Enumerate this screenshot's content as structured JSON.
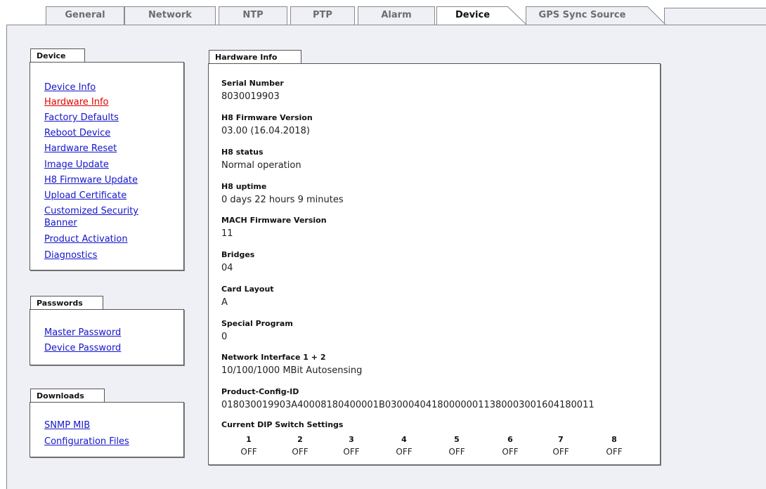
{
  "tabs": [
    {
      "label": "General"
    },
    {
      "label": "Network"
    },
    {
      "label": "NTP"
    },
    {
      "label": "PTP"
    },
    {
      "label": "Alarm"
    },
    {
      "label": "Device"
    },
    {
      "label": "GPS Sync Source"
    }
  ],
  "active_tab": "Device",
  "device_group": {
    "title": "Device",
    "links": [
      {
        "label": "Device Info"
      },
      {
        "label": "Hardware Info"
      },
      {
        "label": "Factory Defaults"
      },
      {
        "label": "Reboot Device"
      },
      {
        "label": "Hardware Reset"
      },
      {
        "label": "Image Update"
      },
      {
        "label": "H8 Firmware Update"
      },
      {
        "label": "Upload Certificate"
      },
      {
        "label": "Customized Security Banner"
      },
      {
        "label": "Product Activation"
      },
      {
        "label": "Diagnostics"
      }
    ],
    "active_link": "Hardware Info"
  },
  "passwords_group": {
    "title": "Passwords",
    "links": [
      {
        "label": "Master Password"
      },
      {
        "label": "Device Password"
      }
    ]
  },
  "downloads_group": {
    "title": "Downloads",
    "links": [
      {
        "label": "SNMP MIB"
      },
      {
        "label": "Configuration Files"
      }
    ]
  },
  "hardware_info": {
    "title": "Hardware Info",
    "fields": [
      {
        "label": "Serial Number",
        "value": "8030019903"
      },
      {
        "label": "H8 Firmware Version",
        "value": "03.00 (16.04.2018)"
      },
      {
        "label": "H8 status",
        "value": "Normal operation"
      },
      {
        "label": "H8 uptime",
        "value": "0 days 22 hours 9 minutes"
      },
      {
        "label": "MACH Firmware Version",
        "value": "11"
      },
      {
        "label": "Bridges",
        "value": "04"
      },
      {
        "label": "Card Layout",
        "value": "A"
      },
      {
        "label": "Special Program",
        "value": "0"
      },
      {
        "label": "Network Interface 1 + 2",
        "value": "10/100/1000 MBit Autosensing"
      },
      {
        "label": "Product-Config-ID",
        "value": "018030019903A40008180400001B030004041800000011380003001604180011"
      }
    ],
    "dip_title": "Current DIP Switch Settings",
    "dip_switches": [
      {
        "num": "1",
        "state": "OFF"
      },
      {
        "num": "2",
        "state": "OFF"
      },
      {
        "num": "3",
        "state": "OFF"
      },
      {
        "num": "4",
        "state": "OFF"
      },
      {
        "num": "5",
        "state": "OFF"
      },
      {
        "num": "6",
        "state": "OFF"
      },
      {
        "num": "7",
        "state": "OFF"
      },
      {
        "num": "8",
        "state": "OFF"
      }
    ]
  },
  "colors": {
    "link": "#1515cc",
    "active_link": "#e30000",
    "panel_bg": "#eef0f6"
  }
}
